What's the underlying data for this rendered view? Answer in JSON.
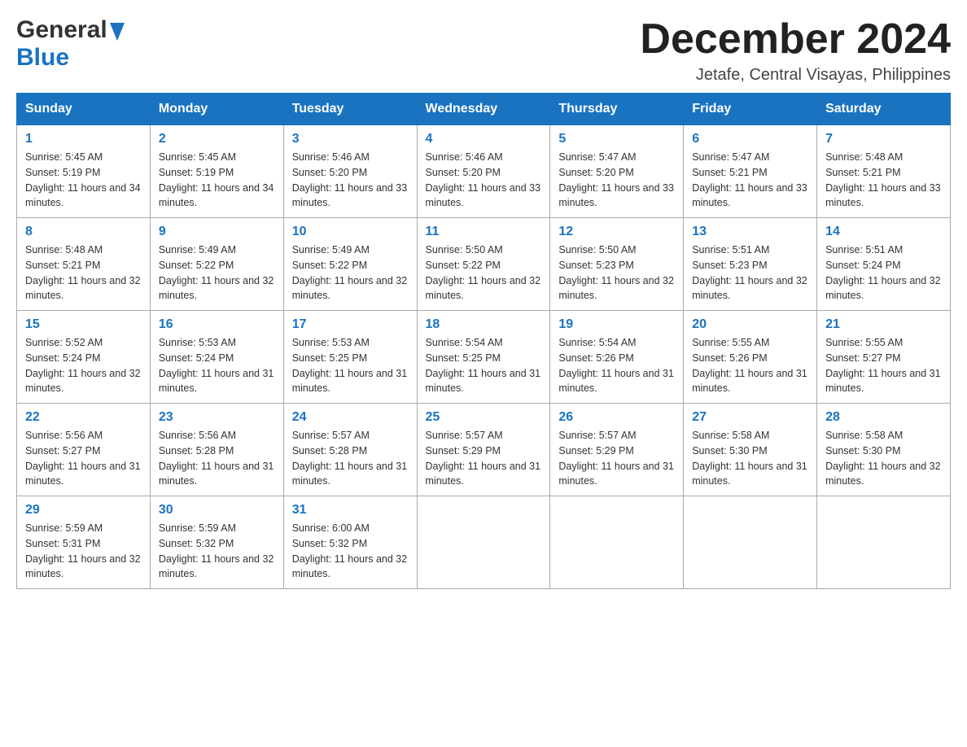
{
  "header": {
    "logo_general": "General",
    "logo_blue": "Blue",
    "month_title": "December 2024",
    "location": "Jetafe, Central Visayas, Philippines"
  },
  "columns": [
    "Sunday",
    "Monday",
    "Tuesday",
    "Wednesday",
    "Thursday",
    "Friday",
    "Saturday"
  ],
  "weeks": [
    [
      {
        "day": "1",
        "sunrise": "Sunrise: 5:45 AM",
        "sunset": "Sunset: 5:19 PM",
        "daylight": "Daylight: 11 hours and 34 minutes."
      },
      {
        "day": "2",
        "sunrise": "Sunrise: 5:45 AM",
        "sunset": "Sunset: 5:19 PM",
        "daylight": "Daylight: 11 hours and 34 minutes."
      },
      {
        "day": "3",
        "sunrise": "Sunrise: 5:46 AM",
        "sunset": "Sunset: 5:20 PM",
        "daylight": "Daylight: 11 hours and 33 minutes."
      },
      {
        "day": "4",
        "sunrise": "Sunrise: 5:46 AM",
        "sunset": "Sunset: 5:20 PM",
        "daylight": "Daylight: 11 hours and 33 minutes."
      },
      {
        "day": "5",
        "sunrise": "Sunrise: 5:47 AM",
        "sunset": "Sunset: 5:20 PM",
        "daylight": "Daylight: 11 hours and 33 minutes."
      },
      {
        "day": "6",
        "sunrise": "Sunrise: 5:47 AM",
        "sunset": "Sunset: 5:21 PM",
        "daylight": "Daylight: 11 hours and 33 minutes."
      },
      {
        "day": "7",
        "sunrise": "Sunrise: 5:48 AM",
        "sunset": "Sunset: 5:21 PM",
        "daylight": "Daylight: 11 hours and 33 minutes."
      }
    ],
    [
      {
        "day": "8",
        "sunrise": "Sunrise: 5:48 AM",
        "sunset": "Sunset: 5:21 PM",
        "daylight": "Daylight: 11 hours and 32 minutes."
      },
      {
        "day": "9",
        "sunrise": "Sunrise: 5:49 AM",
        "sunset": "Sunset: 5:22 PM",
        "daylight": "Daylight: 11 hours and 32 minutes."
      },
      {
        "day": "10",
        "sunrise": "Sunrise: 5:49 AM",
        "sunset": "Sunset: 5:22 PM",
        "daylight": "Daylight: 11 hours and 32 minutes."
      },
      {
        "day": "11",
        "sunrise": "Sunrise: 5:50 AM",
        "sunset": "Sunset: 5:22 PM",
        "daylight": "Daylight: 11 hours and 32 minutes."
      },
      {
        "day": "12",
        "sunrise": "Sunrise: 5:50 AM",
        "sunset": "Sunset: 5:23 PM",
        "daylight": "Daylight: 11 hours and 32 minutes."
      },
      {
        "day": "13",
        "sunrise": "Sunrise: 5:51 AM",
        "sunset": "Sunset: 5:23 PM",
        "daylight": "Daylight: 11 hours and 32 minutes."
      },
      {
        "day": "14",
        "sunrise": "Sunrise: 5:51 AM",
        "sunset": "Sunset: 5:24 PM",
        "daylight": "Daylight: 11 hours and 32 minutes."
      }
    ],
    [
      {
        "day": "15",
        "sunrise": "Sunrise: 5:52 AM",
        "sunset": "Sunset: 5:24 PM",
        "daylight": "Daylight: 11 hours and 32 minutes."
      },
      {
        "day": "16",
        "sunrise": "Sunrise: 5:53 AM",
        "sunset": "Sunset: 5:24 PM",
        "daylight": "Daylight: 11 hours and 31 minutes."
      },
      {
        "day": "17",
        "sunrise": "Sunrise: 5:53 AM",
        "sunset": "Sunset: 5:25 PM",
        "daylight": "Daylight: 11 hours and 31 minutes."
      },
      {
        "day": "18",
        "sunrise": "Sunrise: 5:54 AM",
        "sunset": "Sunset: 5:25 PM",
        "daylight": "Daylight: 11 hours and 31 minutes."
      },
      {
        "day": "19",
        "sunrise": "Sunrise: 5:54 AM",
        "sunset": "Sunset: 5:26 PM",
        "daylight": "Daylight: 11 hours and 31 minutes."
      },
      {
        "day": "20",
        "sunrise": "Sunrise: 5:55 AM",
        "sunset": "Sunset: 5:26 PM",
        "daylight": "Daylight: 11 hours and 31 minutes."
      },
      {
        "day": "21",
        "sunrise": "Sunrise: 5:55 AM",
        "sunset": "Sunset: 5:27 PM",
        "daylight": "Daylight: 11 hours and 31 minutes."
      }
    ],
    [
      {
        "day": "22",
        "sunrise": "Sunrise: 5:56 AM",
        "sunset": "Sunset: 5:27 PM",
        "daylight": "Daylight: 11 hours and 31 minutes."
      },
      {
        "day": "23",
        "sunrise": "Sunrise: 5:56 AM",
        "sunset": "Sunset: 5:28 PM",
        "daylight": "Daylight: 11 hours and 31 minutes."
      },
      {
        "day": "24",
        "sunrise": "Sunrise: 5:57 AM",
        "sunset": "Sunset: 5:28 PM",
        "daylight": "Daylight: 11 hours and 31 minutes."
      },
      {
        "day": "25",
        "sunrise": "Sunrise: 5:57 AM",
        "sunset": "Sunset: 5:29 PM",
        "daylight": "Daylight: 11 hours and 31 minutes."
      },
      {
        "day": "26",
        "sunrise": "Sunrise: 5:57 AM",
        "sunset": "Sunset: 5:29 PM",
        "daylight": "Daylight: 11 hours and 31 minutes."
      },
      {
        "day": "27",
        "sunrise": "Sunrise: 5:58 AM",
        "sunset": "Sunset: 5:30 PM",
        "daylight": "Daylight: 11 hours and 31 minutes."
      },
      {
        "day": "28",
        "sunrise": "Sunrise: 5:58 AM",
        "sunset": "Sunset: 5:30 PM",
        "daylight": "Daylight: 11 hours and 32 minutes."
      }
    ],
    [
      {
        "day": "29",
        "sunrise": "Sunrise: 5:59 AM",
        "sunset": "Sunset: 5:31 PM",
        "daylight": "Daylight: 11 hours and 32 minutes."
      },
      {
        "day": "30",
        "sunrise": "Sunrise: 5:59 AM",
        "sunset": "Sunset: 5:32 PM",
        "daylight": "Daylight: 11 hours and 32 minutes."
      },
      {
        "day": "31",
        "sunrise": "Sunrise: 6:00 AM",
        "sunset": "Sunset: 5:32 PM",
        "daylight": "Daylight: 11 hours and 32 minutes."
      },
      null,
      null,
      null,
      null
    ]
  ]
}
